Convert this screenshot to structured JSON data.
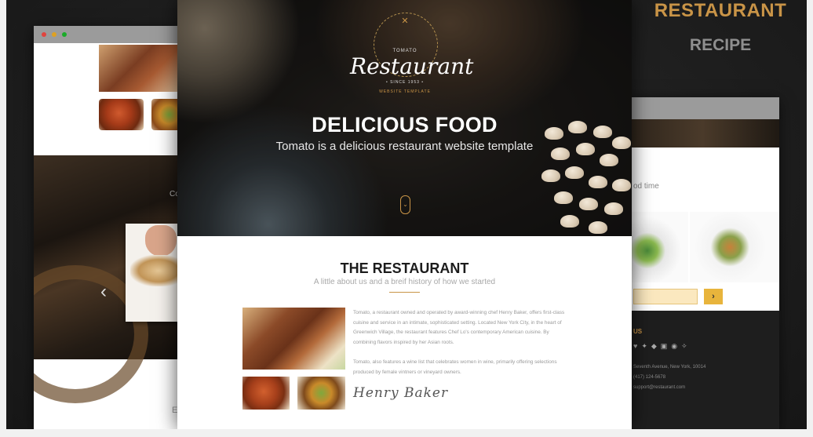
{
  "headline": {
    "line1": "RESTAURANT",
    "line2": "RECIPE"
  },
  "center": {
    "logo": {
      "small": "TOMATO",
      "name": "Restaurant",
      "since": "• SINCE 1953 •",
      "tagline": "WEBSITE TEMPLATE"
    },
    "hero": {
      "title": "DELICIOUS FOOD",
      "subtitle": "Tomato is a delicious restaurant website template"
    },
    "section": {
      "title": "THE RESTAURANT",
      "subtitle": "A little about us and a breif history of how we started",
      "paragraph1": "Tomato, a restaurant owned and operated by award-winning chef Henry Baker, offers first-class cuisine and service in an intimate, sophisticated setting. Located New York City, in the heart of Greenwich Village, the restaurant features Chef Lo's contemporary American cuisine. By combining flavors inspired by her Asian roots.",
      "paragraph2": "Tomato, also features a wine list that celebrates women in wine, primarily offering selections produced by female vintners or vineyard owners.",
      "signature": "Henry Baker"
    }
  },
  "left_mock": {
    "side_text": "Co",
    "bottom_text": "E"
  },
  "right_mock": {
    "text": "od time",
    "button": "›",
    "footer_heading": "US",
    "address": "Seventh Avenue, New York, 10014\n(417) 124-5678\nsupport@restaurant.com"
  },
  "colors": {
    "accent": "#c99447",
    "background": "#1f1f1f"
  }
}
